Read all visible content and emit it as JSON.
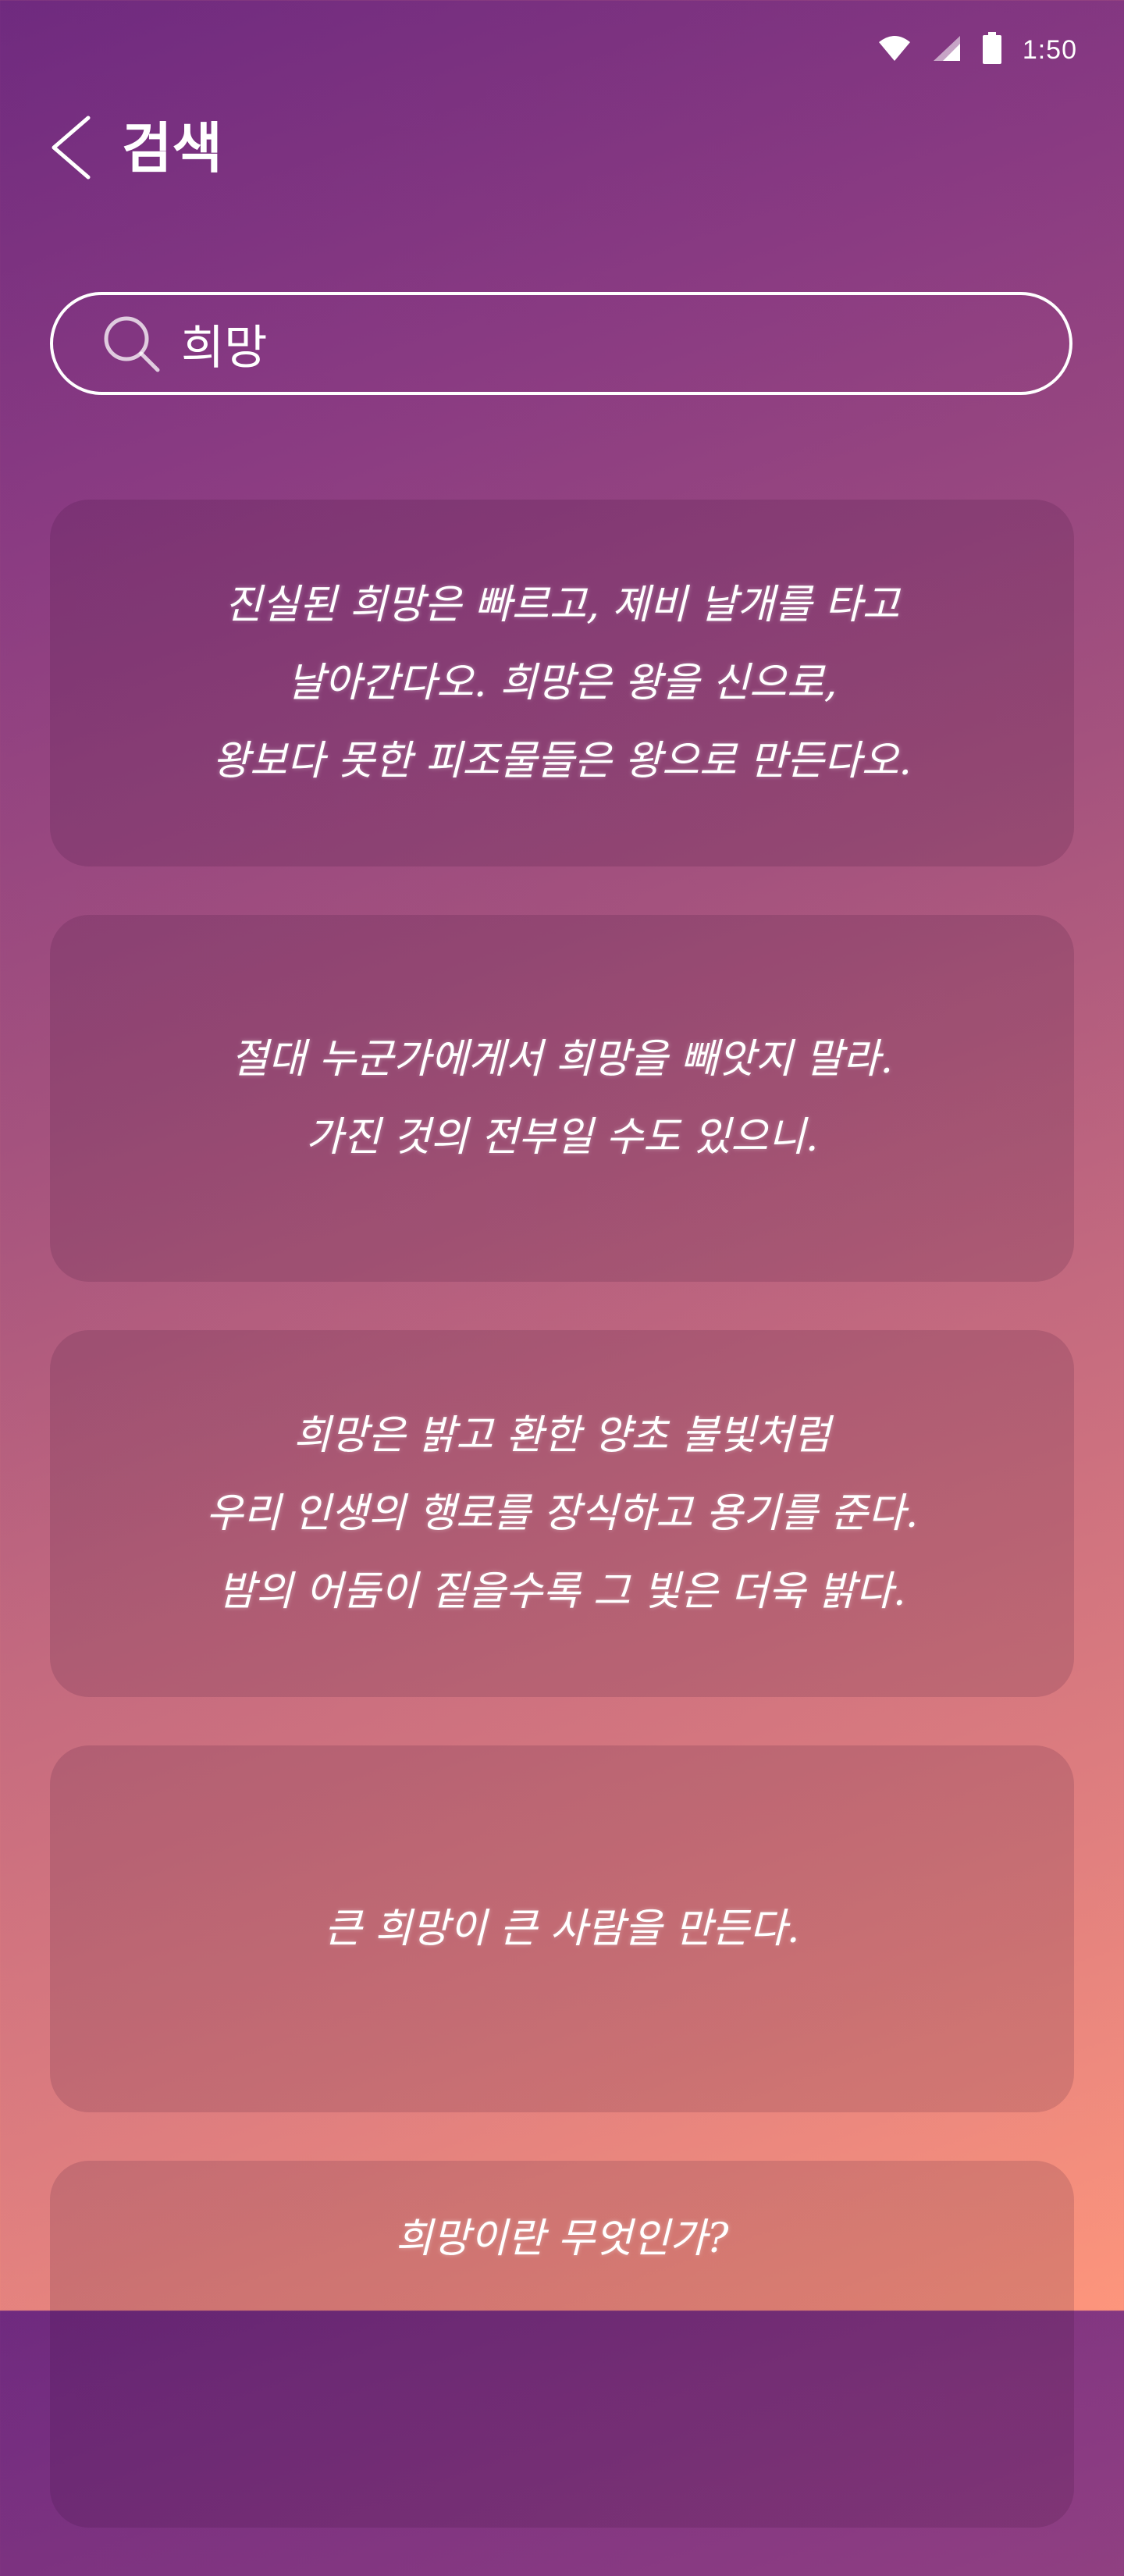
{
  "status_bar": {
    "time": "1:50"
  },
  "header": {
    "back_icon": "chevron-left-icon",
    "title": "검색"
  },
  "search": {
    "icon": "search-icon",
    "value": "희망"
  },
  "results": [
    {
      "quote": "진실된 희망은 빠르고, 제비 날개를 타고\n날아간다오. 희망은 왕을 신으로,\n왕보다 못한 피조물들은 왕으로 만든다오."
    },
    {
      "quote": "절대 누군가에게서 희망을 빼앗지 말라.\n가진 것의 전부일 수도 있으니."
    },
    {
      "quote": "희망은 밝고 환한 양초 불빛처럼\n우리 인생의 행로를 장식하고 용기를 준다.\n밤의 어둠이 짙을수록 그 빛은 더욱 밝다."
    },
    {
      "quote": "큰 희망이 큰 사람을 만든다."
    },
    {
      "quote": "희망이란 무엇인가?"
    }
  ],
  "colors": {
    "gradient_top": "#6f2a7f",
    "gradient_bottom": "#fd957c",
    "text": "#ffffff"
  }
}
